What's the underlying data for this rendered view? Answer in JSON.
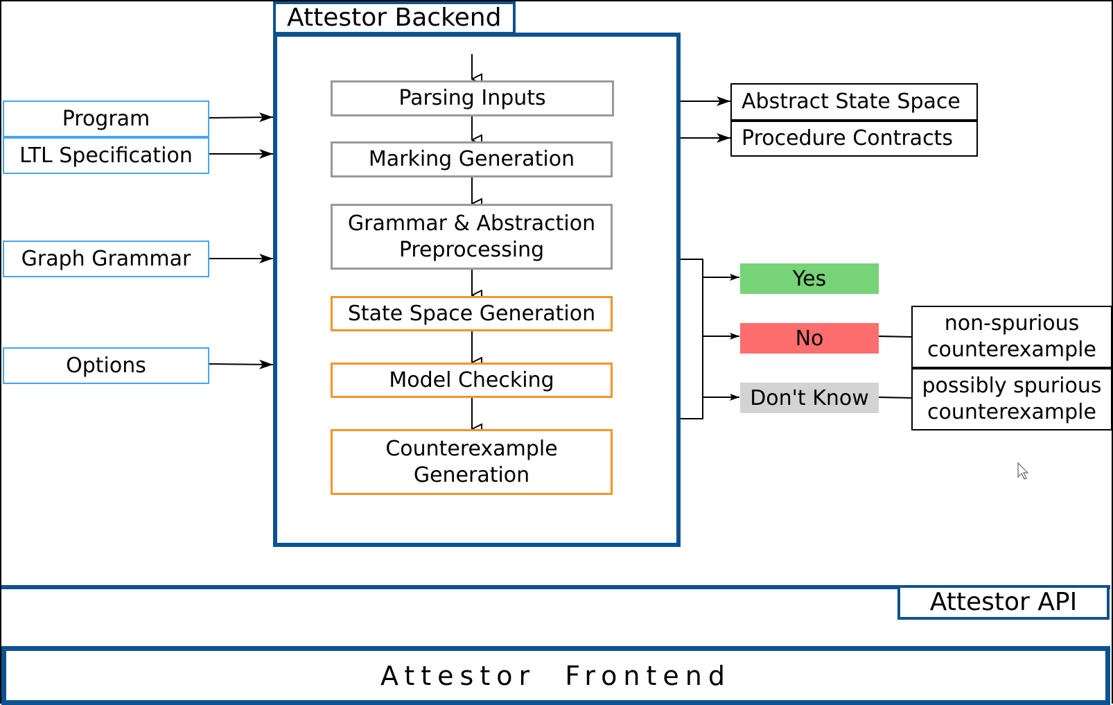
{
  "backend": {
    "title": "Attestor Backend",
    "pipeline": [
      {
        "label": "Parsing Inputs",
        "stage": "grey"
      },
      {
        "label": "Marking Generation",
        "stage": "grey"
      },
      {
        "label": "Grammar & Abstraction Preprocessing",
        "line1": "Grammar & Abstraction",
        "line2": "Preprocessing",
        "stage": "grey"
      },
      {
        "label": "State Space Generation",
        "stage": "orange"
      },
      {
        "label": "Model Checking",
        "stage": "orange"
      },
      {
        "label": "Counterexample Generation",
        "line1": "Counterexample",
        "line2": "Generation",
        "stage": "orange"
      }
    ]
  },
  "inputs": [
    {
      "label": "Program"
    },
    {
      "label": "LTL Specification"
    },
    {
      "label": "Graph Grammar"
    },
    {
      "label": "Options"
    }
  ],
  "outputs": [
    {
      "label": "Abstract State Space"
    },
    {
      "label": "Procedure Contracts"
    }
  ],
  "results": [
    {
      "label": "Yes",
      "color": "#77d377"
    },
    {
      "label": "No",
      "color": "#ff6e6e"
    },
    {
      "label": "Don't Know",
      "color": "#d3d3d3"
    }
  ],
  "counterexamples": [
    {
      "line1": "non-spurious",
      "line2": "counterexample"
    },
    {
      "line1": "possibly spurious",
      "line2": "counterexample"
    }
  ],
  "api": {
    "label": "Attestor API"
  },
  "frontend": {
    "label": "Attestor Frontend"
  },
  "colors": {
    "container_blue": "#0d5290",
    "input_blue": "#42a5f5",
    "preprocessing_grey": "#999999",
    "analysis_orange": "#f0962a"
  }
}
